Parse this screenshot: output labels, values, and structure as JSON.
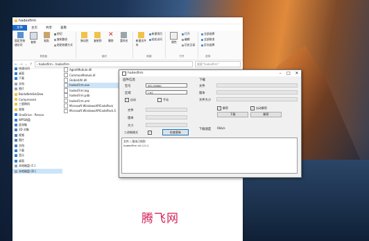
{
  "explorer": {
    "title": "hadesfirm",
    "tabs": [
      "文件",
      "主页",
      "共享",
      "查看"
    ],
    "ribbon": {
      "pin_label": "固定到快速访问",
      "copy_label": "复制",
      "paste_label": "粘贴",
      "cut_label": "剪切",
      "copy_path_label": "复制路径",
      "paste_shortcut_label": "粘贴快捷方式",
      "clipboard_group": "剪贴板",
      "move_to_label": "移动到",
      "copy_to_label": "复制到",
      "delete_label": "删除",
      "rename_label": "重命名",
      "organize_group": "组织",
      "new_item_label": "新建项目",
      "easy_access_label": "轻松访问",
      "new_folder_label": "新建文件夹",
      "new_group": "新建",
      "properties_label": "属性",
      "open_label": "打开",
      "edit_label": "编辑",
      "history_label": "历史记录",
      "open_group": "打开",
      "select_all_label": "全部选择",
      "select_none_label": "全部取消",
      "invert_label": "反向选择",
      "select_group": "选择"
    },
    "address": {
      "path": "› hadesfirm › hadesfirm",
      "search_placeholder": "搜索\"hadesfirm\""
    },
    "nav": [
      {
        "label": "快速访问",
        "color": "#2f7fd6"
      },
      {
        "label": "桌面",
        "color": "#2f7fd6"
      },
      {
        "label": "下载",
        "color": "#2f7fd6"
      },
      {
        "label": "文档",
        "color": "#9aa4ad"
      },
      {
        "label": "图片",
        "color": "#9aa4ad"
      },
      {
        "label": "BaiduNetdiskDow",
        "color": "#f0c24b"
      },
      {
        "label": "Compressed",
        "color": "#f0c24b"
      },
      {
        "label": "三星刷机",
        "color": "#f0c24b"
      },
      {
        "label": "视频",
        "color": "#f0c24b"
      },
      {
        "label": "OneDrive - Person",
        "color": "#2f7fd6"
      },
      {
        "label": "WPS网盘",
        "color": "#2f7fd6"
      },
      {
        "label": "此电脑",
        "color": "#4a7fbf"
      },
      {
        "label": "3D 对象",
        "color": "#4a7fbf"
      },
      {
        "label": "视频",
        "color": "#4a7fbf"
      },
      {
        "label": "图片",
        "color": "#4a7fbf"
      },
      {
        "label": "文档",
        "color": "#4a7fbf"
      },
      {
        "label": "下载",
        "color": "#2f7fd6"
      },
      {
        "label": "音乐",
        "color": "#2f7fd6"
      },
      {
        "label": "桌面",
        "color": "#2f7fd6"
      },
      {
        "label": "本地磁盘 (C:)",
        "color": "#9aa4ad"
      },
      {
        "label": "本地磁盘 (D:)",
        "color": "#9aa4ad"
      }
    ],
    "nav_selected_index": 20,
    "files": [
      "AgentModule.dll",
      "CommonModule.dl",
      "GlobalUtil.dll",
      "hadesFirm.exe",
      "hadesFirm.log",
      "hadesFirm.pdb",
      "hadesFirm.xml",
      "Microsoft.WindowsAPICodePack",
      "Microsoft.WindowsAPICodePack.S"
    ],
    "file_selected_index": 3
  },
  "dialog": {
    "title": "hadesfirm",
    "left_section": "固件信息",
    "model_label": "型号",
    "model_value": "SM-G9860",
    "region_label": "区域",
    "region_value": "CHC",
    "auto_label": "自动",
    "auto_checked": true,
    "manual_label": "手动",
    "manual_checked": false,
    "file_label": "文件",
    "version_label": "版本",
    "size_label": "大小",
    "binary_label": "二进制格式",
    "binary_checked": true,
    "check_update_button": "检查更新",
    "right_section": "下载",
    "file_right_label": "文件",
    "version_right_label": "版本",
    "size_right_label": "文件大小",
    "decrypt_label": "解密",
    "decrypt_checked": true,
    "auto_decrypt_label": "自动解密",
    "auto_decrypt_checked": true,
    "download_button": "下载",
    "decrypt_button": "解密",
    "speed_label": "下载速度",
    "speed_value": "0kb/s",
    "log_line1": "文件: \\ 版本已找到",
    "log_line2": "hadesFirm v0.1.0.1"
  },
  "watermark": "腾飞网"
}
